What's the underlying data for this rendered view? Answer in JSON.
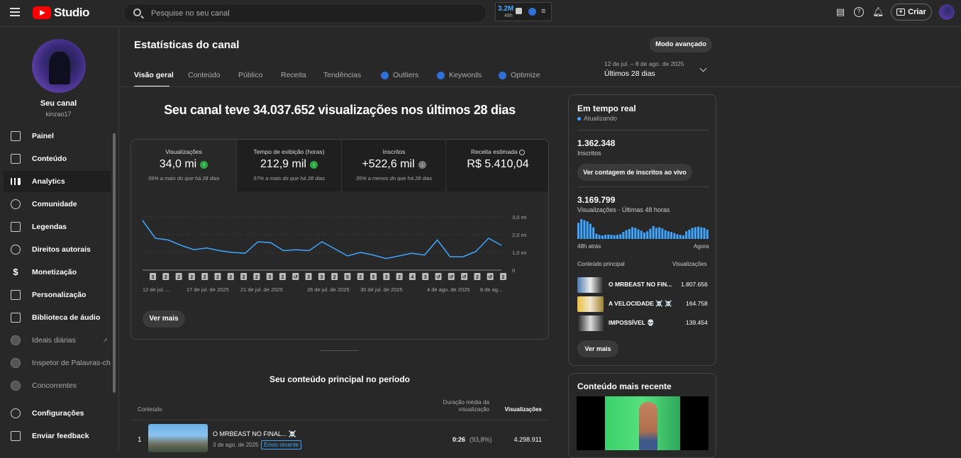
{
  "topbar": {
    "logo_text": "Studio",
    "search_placeholder": "Pesquise no seu canal",
    "ext_value": "3.2M",
    "ext_sub": "48h",
    "create_label": "Criar"
  },
  "sidebar": {
    "channel_name": "Seu canal",
    "channel_handle": "kinzao17",
    "items": [
      {
        "label": "Painel",
        "icon": "dashboard-icon"
      },
      {
        "label": "Conteúdo",
        "icon": "content-icon"
      },
      {
        "label": "Analytics",
        "icon": "analytics-icon"
      },
      {
        "label": "Comunidade",
        "icon": "community-icon"
      },
      {
        "label": "Legendas",
        "icon": "subtitles-icon"
      },
      {
        "label": "Direitos autorais",
        "icon": "copyright-icon"
      },
      {
        "label": "Monetização",
        "icon": "dollar-icon"
      },
      {
        "label": "Personalização",
        "icon": "magic-wand-icon"
      },
      {
        "label": "Biblioteca de áudio",
        "icon": "audio-library-icon"
      },
      {
        "label": "Ideais diárias",
        "icon": "extension-icon"
      },
      {
        "label": "Inspetor de Palavras-chav",
        "icon": "extension-icon"
      },
      {
        "label": "Concorrentes",
        "icon": "extension-icon"
      },
      {
        "label": "Configurações",
        "icon": "gear-icon"
      },
      {
        "label": "Enviar feedback",
        "icon": "feedback-icon"
      }
    ]
  },
  "main": {
    "page_title": "Estatísticas do canal",
    "advanced_mode": "Modo avançado",
    "tabs": [
      "Visão geral",
      "Conteúdo",
      "Público",
      "Receita",
      "Tendências",
      "Outliers",
      "Keywords",
      "Optimize"
    ],
    "date_range": "12 de jul. – 8 de ago. de 2025",
    "date_period": "Últimos 28 dias",
    "headline": "Seu canal teve 34.037.652 visualizações nos últimos 28 dias",
    "metrics": [
      {
        "label": "Visualizações",
        "value": "34,0 mi",
        "sub": "39% a mais do que há 28 dias",
        "trend": "up"
      },
      {
        "label": "Tempo de exibição (horas)",
        "value": "212,9 mil",
        "sub": "37% a mais do que há 28 dias",
        "trend": "up"
      },
      {
        "label": "Inscritos",
        "value": "+522,6 mil",
        "sub": "35% a menos do que há 28 dias",
        "trend": "down"
      },
      {
        "label": "Receita estimada",
        "value": "R$ 5.410,04",
        "sub": "",
        "trend": ""
      }
    ],
    "see_more": "Ver mais",
    "top_content_title": "Seu conteúdo principal no período",
    "table_headers": {
      "content": "Conteúdo",
      "avg_duration": "Duração média da visualização",
      "views": "Visualizações"
    },
    "top_rows": [
      {
        "rank": "1",
        "title": "O MRBEAST NO FINAL... ☠️",
        "date": "3 de ago. de 2025",
        "badge": "Envio recente",
        "duration": "0:26",
        "pct": "(93,8%)",
        "views": "4.298.911"
      }
    ]
  },
  "chart_data": {
    "type": "line",
    "y_ticks": [
      "3,0 mi",
      "2,0 mi",
      "1,0 mi",
      "0"
    ],
    "ylim": [
      0,
      3000000
    ],
    "x_labels": [
      "12 de jul. ...",
      "17 de jul. de 2025",
      "21 de jul. de 2025",
      "26 de jul. de 2025",
      "30 de jul. de 2025",
      "4 de ago. de 2025",
      "8 de ag..."
    ],
    "values": [
      2800000,
      1800000,
      1700000,
      1400000,
      1150000,
      1250000,
      1100000,
      1000000,
      950000,
      1600000,
      1550000,
      1100000,
      1150000,
      1100000,
      1600000,
      1200000,
      800000,
      1000000,
      850000,
      650000,
      800000,
      950000,
      850000,
      1700000,
      750000,
      750000,
      1050000,
      1800000,
      1400000
    ],
    "markers": [
      "3",
      "2",
      "2",
      "2",
      "2",
      "2",
      "2",
      "2",
      "2",
      "3",
      "2",
      "↺",
      "3",
      "3",
      "2",
      "5",
      "2",
      "5",
      "3",
      "2",
      "4",
      "3",
      "↺",
      "↺",
      "↺",
      "2",
      "↺",
      "2"
    ],
    "color": "#3ea6ff"
  },
  "realtime": {
    "title": "Em tempo real",
    "status": "Atualizando",
    "subs_value": "1.362.348",
    "subs_label": "Inscritos",
    "subs_button": "Ver contagem de inscritos ao vivo",
    "views_value": "3.169.799",
    "views_label": "Visualizações · Últimas 48 horas",
    "bars": [
      55,
      68,
      64,
      60,
      52,
      40,
      18,
      14,
      12,
      14,
      15,
      14,
      13,
      14,
      16,
      24,
      30,
      34,
      40,
      38,
      33,
      28,
      22,
      26,
      35,
      44,
      38,
      40,
      36,
      30,
      26,
      24,
      20,
      16,
      14,
      12,
      26,
      32,
      38,
      40,
      42,
      40,
      38,
      32
    ],
    "label_start": "48h atrás",
    "label_end": "Agora",
    "top_label": "Conteúdo principal",
    "views_col": "Visualizações",
    "top_items": [
      {
        "title": "O MRBEAST NO FIN...",
        "views": "1.807.656"
      },
      {
        "title": "A VELOCIDADE ☠️ ☠️",
        "views": "164.758"
      },
      {
        "title": "IMPOSSÍVEL 💀",
        "views": "139.454"
      }
    ],
    "see_more": "Ver mais",
    "recent_title": "Conteúdo mais recente"
  }
}
